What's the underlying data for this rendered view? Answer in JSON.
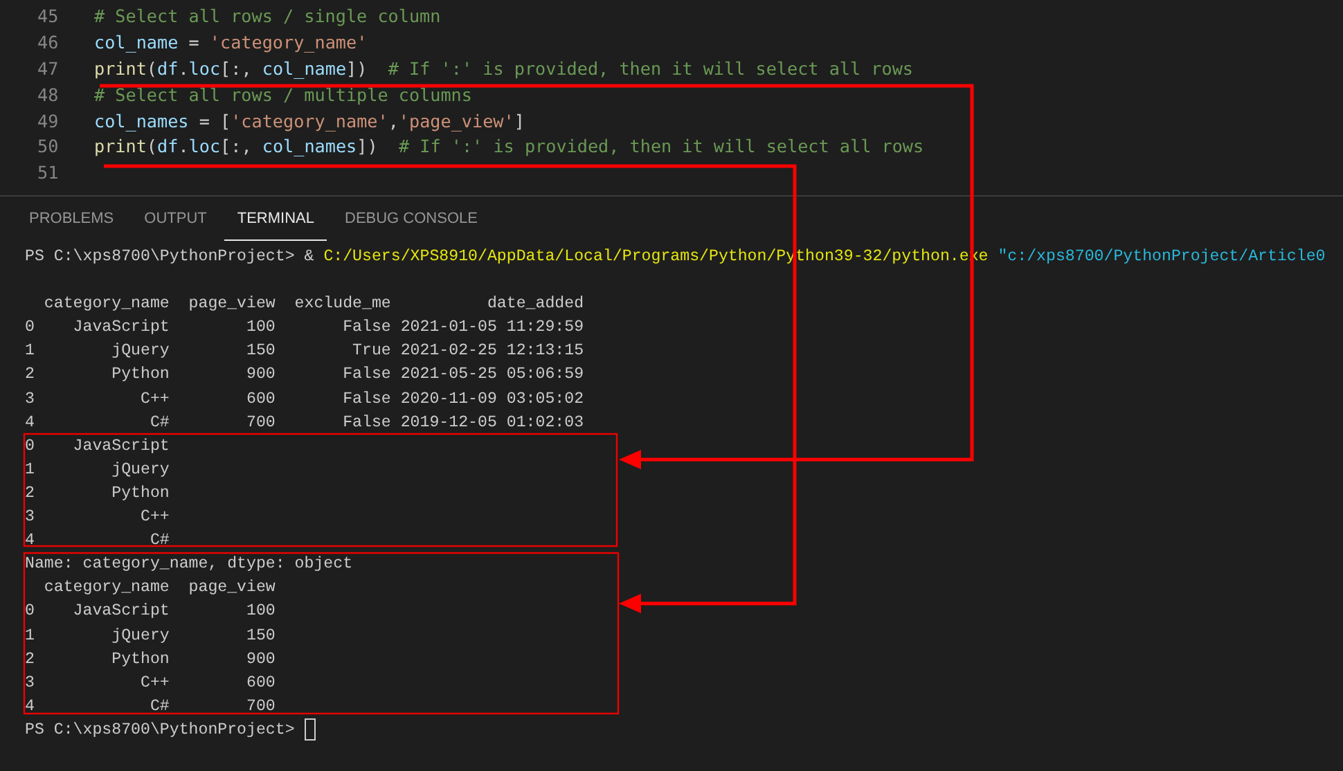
{
  "editor": {
    "lines": [
      {
        "number": "45",
        "tokens": [
          {
            "kind": "comment",
            "text": "# Select all rows / single column"
          }
        ]
      },
      {
        "number": "46",
        "tokens": [
          {
            "kind": "variable",
            "text": "col_name"
          },
          {
            "kind": "plain",
            "text": " = "
          },
          {
            "kind": "string",
            "text": "'category_name'"
          }
        ]
      },
      {
        "number": "47",
        "tokens": [
          {
            "kind": "function",
            "text": "print"
          },
          {
            "kind": "plain",
            "text": "("
          },
          {
            "kind": "variable",
            "text": "df"
          },
          {
            "kind": "plain",
            "text": "."
          },
          {
            "kind": "variable",
            "text": "loc"
          },
          {
            "kind": "plain",
            "text": "[:, "
          },
          {
            "kind": "variable",
            "text": "col_name"
          },
          {
            "kind": "plain",
            "text": "])  "
          },
          {
            "kind": "comment",
            "text": "# If ':' is provided, then it will select all rows"
          }
        ]
      },
      {
        "number": "48",
        "tokens": [
          {
            "kind": "comment",
            "text": "# Select all rows / multiple columns"
          }
        ]
      },
      {
        "number": "49",
        "tokens": [
          {
            "kind": "variable",
            "text": "col_names"
          },
          {
            "kind": "plain",
            "text": " = ["
          },
          {
            "kind": "string",
            "text": "'category_name'"
          },
          {
            "kind": "plain",
            "text": ","
          },
          {
            "kind": "string",
            "text": "'page_view'"
          },
          {
            "kind": "plain",
            "text": "]"
          }
        ]
      },
      {
        "number": "50",
        "tokens": [
          {
            "kind": "function",
            "text": "print"
          },
          {
            "kind": "plain",
            "text": "("
          },
          {
            "kind": "variable",
            "text": "df"
          },
          {
            "kind": "plain",
            "text": "."
          },
          {
            "kind": "variable",
            "text": "loc"
          },
          {
            "kind": "plain",
            "text": "[:, "
          },
          {
            "kind": "variable",
            "text": "col_names"
          },
          {
            "kind": "plain",
            "text": "])  "
          },
          {
            "kind": "comment",
            "text": "# If ':' is provided, then it will select all rows"
          }
        ]
      },
      {
        "number": "51"
      }
    ]
  },
  "panel": {
    "tabs": [
      {
        "label": "PROBLEMS",
        "selected": false
      },
      {
        "label": "OUTPUT",
        "selected": false
      },
      {
        "label": "TERMINAL",
        "selected": true
      },
      {
        "label": "DEBUG CONSOLE",
        "selected": false
      }
    ]
  },
  "terminal": {
    "command": [
      {
        "kind": "plain",
        "text": "PS C:\\xps8700\\PythonProject> & "
      },
      {
        "kind": "path",
        "text": "C:/Users/XPS8910/AppData/Local/Programs/Python/Python39-32/python.exe"
      },
      {
        "kind": "argument",
        "text": " \"c:/xps8700/PythonProject/Article0"
      }
    ],
    "output": [
      "  category_name  page_view  exclude_me          date_added",
      "0    JavaScript        100       False 2021-01-05 11:29:59",
      "1        jQuery        150        True 2021-02-25 12:13:15",
      "2        Python        900       False 2021-05-25 05:06:59",
      "3           C++        600       False 2020-11-09 03:05:02",
      "4            C#        700       False 2019-12-05 01:02:03",
      "0    JavaScript",
      "1        jQuery",
      "2        Python",
      "3           C++",
      "4            C#",
      "Name: category_name, dtype: object",
      "  category_name  page_view",
      "0    JavaScript        100",
      "1        jQuery        150",
      "2        Python        900",
      "3           C++        600",
      "4            C#        700"
    ],
    "prompt": "PS C:\\xps8700\\PythonProject> ",
    "cursor": true
  }
}
